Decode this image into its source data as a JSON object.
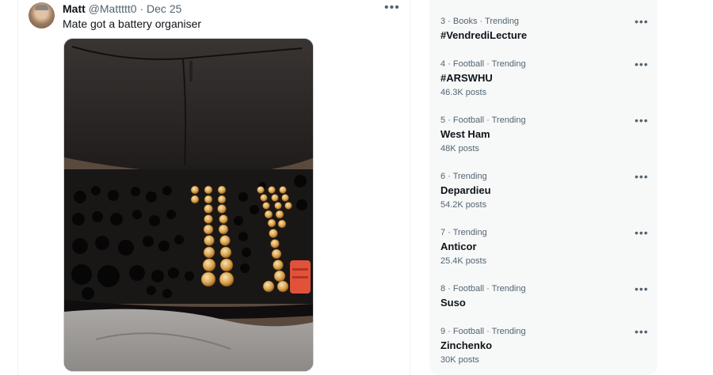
{
  "tweet": {
    "author_name": "Matt",
    "handle": "@Mattttt0",
    "separator": "·",
    "date": "Dec 25",
    "text": "Mate got a battery organiser",
    "more_icon": "more-horizontal-icon"
  },
  "trends": [
    {
      "meta": "3 · Books · Trending",
      "name": "#VendrediLecture",
      "posts": ""
    },
    {
      "meta": "4 · Football · Trending",
      "name": "#ARSWHU",
      "posts": "46.3K posts"
    },
    {
      "meta": "5 · Football · Trending",
      "name": "West Ham",
      "posts": "48K posts"
    },
    {
      "meta": "6 · Trending",
      "name": "Depardieu",
      "posts": "54.2K posts"
    },
    {
      "meta": "7 · Trending",
      "name": "Anticor",
      "posts": "25.4K posts"
    },
    {
      "meta": "8 · Football · Trending",
      "name": "Suso",
      "posts": ""
    },
    {
      "meta": "9 · Football · Trending",
      "name": "Zinchenko",
      "posts": "30K posts"
    }
  ],
  "colors": {
    "text_primary": "#0f1419",
    "text_secondary": "#536471",
    "sidebar_bg": "#f7f9f9",
    "border": "#eff3f4"
  }
}
